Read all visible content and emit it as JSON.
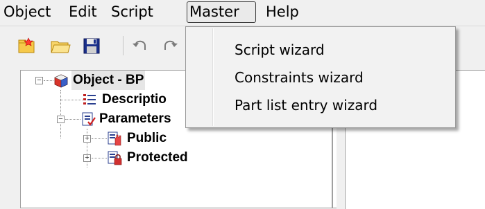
{
  "menubar": {
    "items": [
      {
        "label": "Object"
      },
      {
        "label": "Edit"
      },
      {
        "label": "Script"
      },
      {
        "label": "Master"
      },
      {
        "label": "Help"
      }
    ]
  },
  "toolbar": {
    "icons": [
      "new-icon",
      "open-folder-icon",
      "save-icon",
      "undo-icon",
      "redo-icon"
    ]
  },
  "dropdown": {
    "items": [
      {
        "label": "Script wizard"
      },
      {
        "label": "Constraints wizard"
      },
      {
        "label": "Part list entry wizard"
      }
    ]
  },
  "tree": {
    "root": {
      "label": "Object - BP"
    },
    "children": [
      {
        "label": "Descriptio"
      },
      {
        "label": "Parameters"
      },
      {
        "label": "Public"
      },
      {
        "label": "Protected"
      }
    ]
  },
  "colors": {
    "menu_active_border": "#3c3c3c",
    "dropdown_bg": "#f2f2f2",
    "selection_bg": "#e6e6e6"
  }
}
